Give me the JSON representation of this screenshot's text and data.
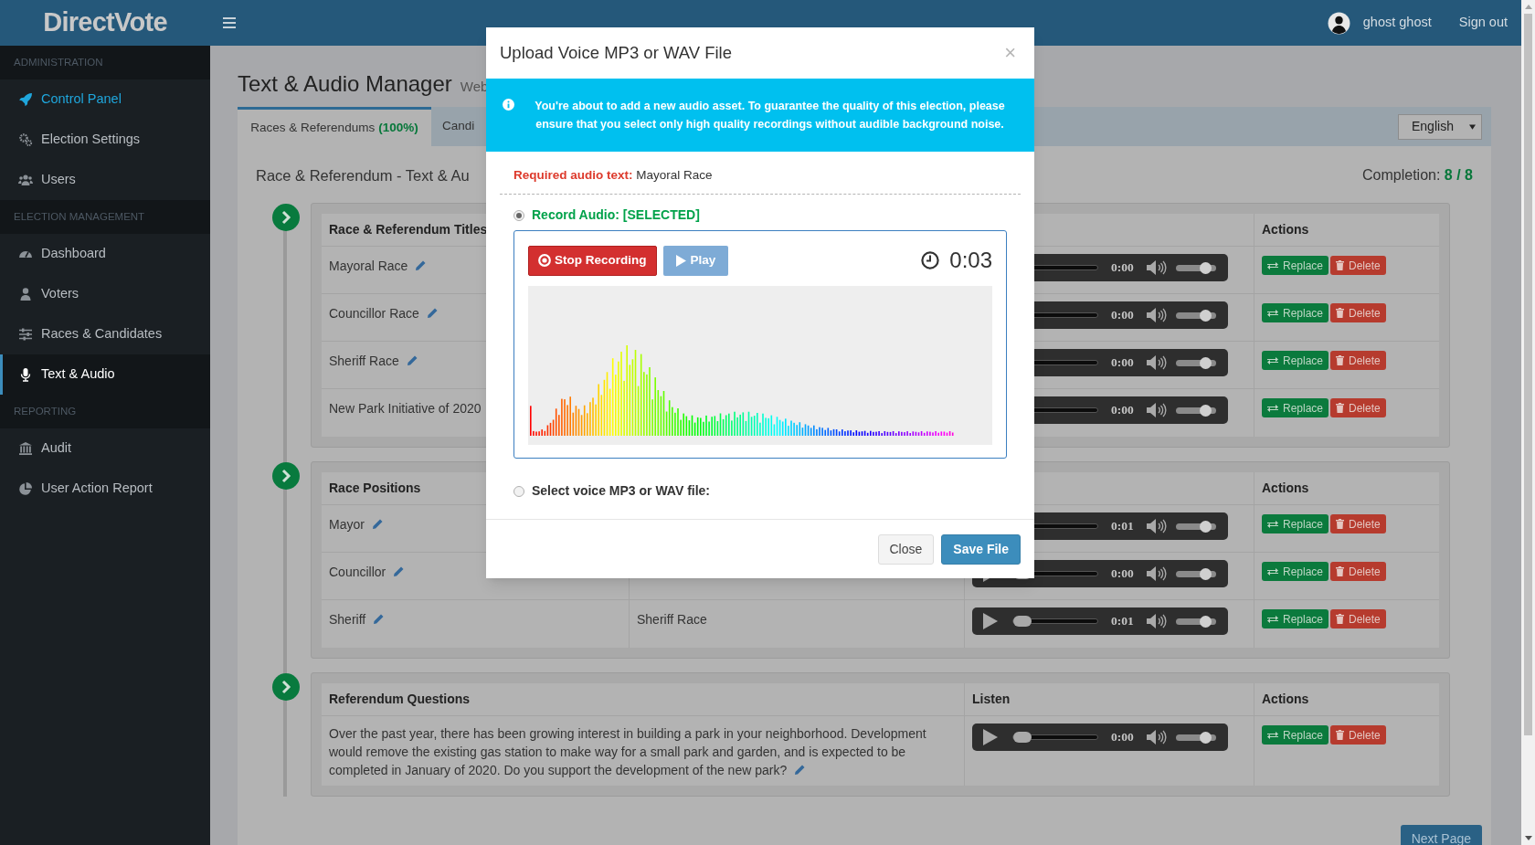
{
  "brand": {
    "name": "DirectVote"
  },
  "header": {
    "user_name": "ghost ghost",
    "sign_out": "Sign out"
  },
  "sidebar": {
    "sections": [
      {
        "heading": "ADMINISTRATION",
        "items": [
          {
            "label": "Control Panel",
            "selected": false,
            "highlighted": true
          },
          {
            "label": "Election Settings",
            "selected": false,
            "highlighted": false
          },
          {
            "label": "Users",
            "selected": false,
            "highlighted": false
          }
        ]
      },
      {
        "heading": "ELECTION MANAGEMENT",
        "items": [
          {
            "label": "Dashboard",
            "selected": false,
            "highlighted": false
          },
          {
            "label": "Voters",
            "selected": false,
            "highlighted": false
          },
          {
            "label": "Races & Candidates",
            "selected": false,
            "highlighted": false
          },
          {
            "label": "Text & Audio",
            "selected": true,
            "highlighted": false
          }
        ]
      },
      {
        "heading": "REPORTING",
        "items": [
          {
            "label": "Audit",
            "selected": false,
            "highlighted": false
          },
          {
            "label": "User Action Report",
            "selected": false,
            "highlighted": false
          }
        ]
      }
    ]
  },
  "page": {
    "title": "Text & Audio Manager",
    "subtitle": "Web",
    "tabs": [
      {
        "label": "Races & Referendums",
        "badge": "(100%)",
        "selected": true
      },
      {
        "label": "Candi",
        "selected": false
      }
    ],
    "language": "English",
    "section_title": "Race & Referendum - Text & Au",
    "completion": {
      "label": "Completion:",
      "value": "8 / 8"
    }
  },
  "tables": [
    {
      "kind": "standard",
      "headers": {
        "title": "Race & Referendum Titles",
        "actions": "Actions"
      },
      "rows": [
        {
          "title": "Mayoral Race",
          "editable": true,
          "player": {
            "time": "0:00",
            "volume": {
              "level": 0.85
            }
          },
          "actions": [
            {
              "label": "Replace",
              "kind": "replace"
            },
            {
              "label": "Delete",
              "kind": "delete"
            }
          ]
        },
        {
          "title": "Councillor Race",
          "editable": true,
          "player": {
            "time": "0:00",
            "volume": {
              "level": 0.85
            }
          },
          "actions": [
            {
              "label": "Replace",
              "kind": "replace"
            },
            {
              "label": "Delete",
              "kind": "delete"
            }
          ]
        },
        {
          "title": "Sheriff Race",
          "editable": true,
          "player": {
            "time": "0:00",
            "volume": {
              "level": 0.85
            }
          },
          "actions": [
            {
              "label": "Replace",
              "kind": "replace"
            },
            {
              "label": "Delete",
              "kind": "delete"
            }
          ]
        },
        {
          "title": "New Park Initiative of 2020",
          "editable": false,
          "player": {
            "time": "0:00",
            "volume": {
              "level": 0.85
            }
          },
          "actions": [
            {
              "label": "Replace",
              "kind": "replace"
            },
            {
              "label": "Delete",
              "kind": "delete"
            }
          ]
        }
      ]
    },
    {
      "kind": "standard",
      "headers": {
        "title": "Race Positions",
        "actions": "Actions"
      },
      "rows": [
        {
          "title": "Mayor",
          "editable": true,
          "player": {
            "time": "0:01",
            "volume": {
              "level": 0.85
            }
          },
          "actions": [
            {
              "label": "Replace",
              "kind": "replace"
            },
            {
              "label": "Delete",
              "kind": "delete"
            }
          ]
        },
        {
          "title": "Councillor",
          "editable": true,
          "player": {
            "time": "0:00",
            "progress": {
              "level": 0
            },
            "volume": {
              "level": 0.85
            }
          },
          "actions": [
            {
              "label": "Replace",
              "kind": "replace"
            },
            {
              "label": "Delete",
              "kind": "delete"
            }
          ]
        },
        {
          "title": "Sheriff",
          "editable": true,
          "race": "Sheriff Race",
          "player": {
            "time": "0:01",
            "progress": {
              "level": 0
            },
            "volume": {
              "level": 0.85
            }
          },
          "actions": [
            {
              "label": "Replace",
              "kind": "replace"
            },
            {
              "label": "Delete",
              "kind": "delete"
            }
          ]
        }
      ]
    },
    {
      "kind": "questions",
      "headers": {
        "title": "Referendum Questions",
        "listen": "Listen",
        "actions": "Actions"
      },
      "rows": [
        {
          "title": "Over the past year, there has been growing interest in building a park in your neighborhood. Development would remove the existing gas station to make way for a small park and garden, and is expected to be completed in January of 2020. Do you support the development of the new park?",
          "editable": true,
          "player": {
            "time": "0:00",
            "progress": {
              "level": 0
            },
            "volume": {
              "level": 0.85
            }
          },
          "actions": [
            {
              "label": "Replace",
              "kind": "replace"
            },
            {
              "label": "Delete",
              "kind": "delete"
            }
          ]
        }
      ]
    }
  ],
  "next_button": "Next Page",
  "modal": {
    "title": "Upload Voice MP3 or WAV File",
    "close": "×",
    "notice": "You're about to add a new audio asset. To guarantee the quality of this election, please ensure that you select only high quality recordings without audible background noise.",
    "required_label": "Required audio text:",
    "required_text": "Mayoral Race",
    "options": [
      {
        "label": "Record Audio: [SELECTED]",
        "kind": "record",
        "selected": true
      },
      {
        "label": "Select voice MP3 or WAV file:",
        "kind": "file",
        "selected": false
      }
    ],
    "recorder": {
      "stop": "Stop Recording",
      "play": "Play",
      "play_disabled": true,
      "elapsed": "0:03"
    },
    "buttons": [
      {
        "label": "Close",
        "kind": "default"
      },
      {
        "label": "Save File",
        "kind": "primary"
      }
    ]
  }
}
